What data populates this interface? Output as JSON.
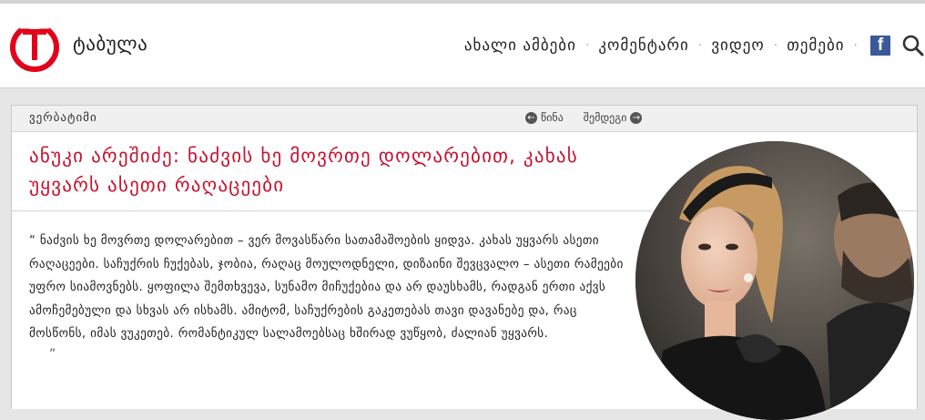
{
  "header": {
    "brand": "ტაბულა",
    "nav": [
      "ახალი ამბები",
      "კომენტარი",
      "ვიდეო",
      "თემები"
    ],
    "separator": "·",
    "facebook_glyph": "f",
    "icons": [
      "facebook-icon",
      "search-icon"
    ]
  },
  "section": {
    "label": "ვერბატიმი",
    "prev": "წინა",
    "next": "შემდეგი"
  },
  "article": {
    "title": "ანუკი არეშიძე: ნაძვის ხე მოვრთე დოლარებით, კახას უყვარს ასეთი რაღაცეები",
    "quote_open": "“",
    "quote": "ნაძვის ხე მოვრთე დოლარებით – ვერ მოვასწარი სათამაშოების ყიდვა. კახას უყვარს ასეთი რაღაცეები. საჩუქრის ჩუქებას, ჯობია, რაღაც მოულოდნელი, დიზაინი შევცვალო – ასეთი რამეები უფრო სიამოვნებს. ყოფილა შემთხვევა, სუნამო მიჩუქებია და არ დაუსხამს, რადგან ერთი აქვს ამოჩემებული და სხვას არ ისხამს. ამიტომ, საჩუქრების გაკეთებას თავი დავანებე და, რაც მოსწონს, იმას ვუკეთებ. რომანტიკულ სალამოებსაც ხშირად ვუწყობ, ძალიან უყვარს.",
    "quote_close": "”"
  },
  "colors": {
    "brand_red": "#e2001a",
    "title_red": "#c8102e",
    "facebook_blue": "#3b5998"
  }
}
